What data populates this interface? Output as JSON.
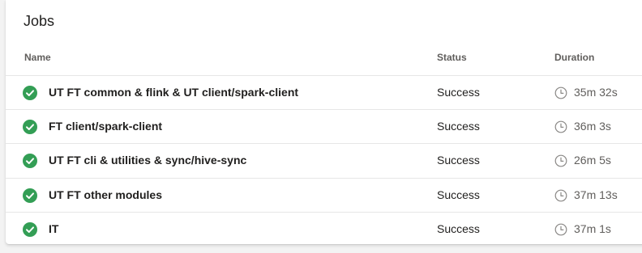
{
  "panel": {
    "title": "Jobs",
    "columns": {
      "name": "Name",
      "status": "Status",
      "duration": "Duration"
    }
  },
  "colors": {
    "success": "#339e55",
    "clock": "#8a8886"
  },
  "jobs": [
    {
      "name": "UT FT common & flink & UT client/spark-client",
      "status": "Success",
      "status_icon": "check-circle-icon",
      "duration": "35m 32s"
    },
    {
      "name": "FT client/spark-client",
      "status": "Success",
      "status_icon": "check-circle-icon",
      "duration": "36m 3s"
    },
    {
      "name": "UT FT cli & utilities & sync/hive-sync",
      "status": "Success",
      "status_icon": "check-circle-icon",
      "duration": "26m 5s"
    },
    {
      "name": "UT FT other modules",
      "status": "Success",
      "status_icon": "check-circle-icon",
      "duration": "37m 13s"
    },
    {
      "name": "IT",
      "status": "Success",
      "status_icon": "check-circle-icon",
      "duration": "37m 1s"
    }
  ]
}
